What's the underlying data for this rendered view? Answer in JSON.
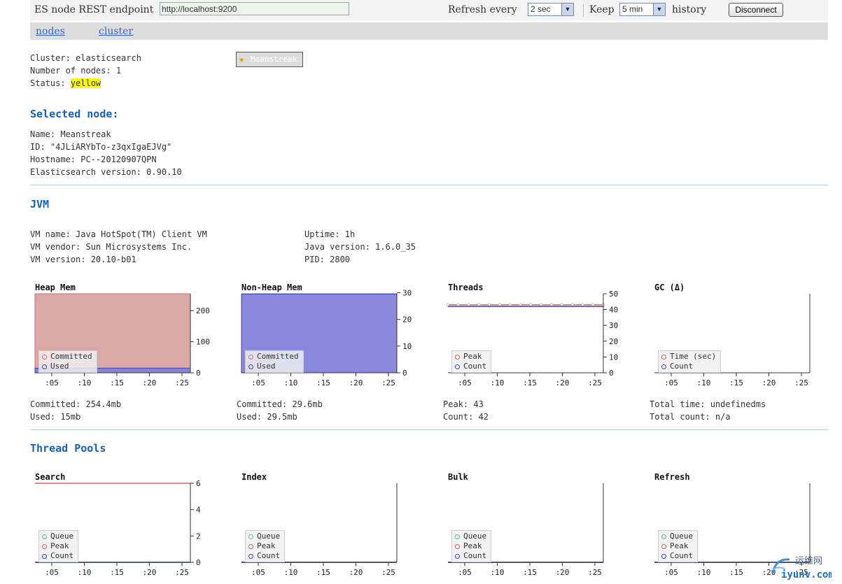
{
  "toolbar": {
    "endpoint_label": "ES node REST endpoint",
    "endpoint_value": "http://localhost:9200",
    "refresh_label": "Refresh every",
    "refresh_value": "2 sec",
    "keep_label": "Keep",
    "keep_value": "5 min",
    "history_label": "history",
    "disconnect_label": "Disconnect"
  },
  "nav": {
    "nodes": "nodes",
    "cluster": "cluster"
  },
  "cluster": {
    "name_line": "Cluster: elasticsearch",
    "nodes_line": "Number of nodes: 1",
    "status_label": "Status: ",
    "status_value": "yellow",
    "node_badge": "Meanstreak"
  },
  "selected_node": {
    "heading": "Selected node:",
    "name_line": "Name: Meanstreak",
    "id_line": "ID: \"4JLiARYbTo-z3qxIgaEJVg\"",
    "hostname_line": "Hostname: PC--20120907QPN",
    "version_line": "Elasticsearch version: 0.90.10"
  },
  "jvm": {
    "heading": "JVM",
    "vm_name": "VM name: Java HotSpot(TM) Client VM",
    "vm_vendor": "VM vendor: Sun Microsystems Inc.",
    "vm_version": "VM version: 20.10-b01",
    "uptime": "Uptime: 1h",
    "java_version": "Java version: 1.6.0_35",
    "pid": "PID: 2800"
  },
  "thread_pools_heading": "Thread Pools",
  "colors": {
    "committed": "#c87070",
    "used": "#4444aa",
    "queue": "#66bb99",
    "peak": "#cc6666",
    "count": "#4444aa",
    "heading": "#1560bd",
    "status_highlight": "#ffff00"
  },
  "chart_data": [
    {
      "id": "heap",
      "type": "area",
      "title": "Heap Mem",
      "x": [
        ":05",
        ":10",
        ":15",
        ":20",
        ":25"
      ],
      "ylim": [
        0,
        254.4
      ],
      "y_ticks": [
        "0",
        "100",
        "200"
      ],
      "series": [
        {
          "name": "Committed",
          "values": [
            254.4,
            254.4,
            254.4,
            254.4,
            254.4,
            254.4
          ]
        },
        {
          "name": "Used",
          "values": [
            15,
            15,
            15,
            15,
            15,
            15
          ]
        }
      ],
      "legend_position": "bottom-left",
      "stats": [
        "Committed: 254.4mb",
        "Used: 15mb"
      ]
    },
    {
      "id": "nonheap",
      "type": "area",
      "title": "Non-Heap Mem",
      "x": [
        ":05",
        ":10",
        ":15",
        ":20",
        ":25"
      ],
      "ylim": [
        0,
        29.6
      ],
      "y_ticks": [
        "0",
        "10",
        "20",
        "30"
      ],
      "series": [
        {
          "name": "Committed",
          "values": [
            29.6,
            29.6,
            29.6,
            29.6,
            29.6,
            29.6
          ]
        },
        {
          "name": "Used",
          "values": [
            29.5,
            29.5,
            29.5,
            29.5,
            29.5,
            29.5
          ]
        }
      ],
      "legend_position": "bottom-left",
      "stats": [
        "Committed: 29.6mb",
        "Used: 29.5mb"
      ]
    },
    {
      "id": "threads",
      "type": "line",
      "title": "Threads",
      "x": [
        ":05",
        ":10",
        ":15",
        ":20",
        ":25"
      ],
      "ylim": [
        0,
        50
      ],
      "y_ticks": [
        "0",
        "10",
        "20",
        "30",
        "40",
        "50"
      ],
      "series": [
        {
          "name": "Peak",
          "values": [
            43,
            43,
            43,
            43,
            43,
            43,
            43,
            43,
            43,
            43,
            43,
            43,
            43,
            43,
            43,
            43
          ]
        },
        {
          "name": "Count",
          "values": [
            42,
            42,
            42,
            42,
            42,
            42,
            42,
            42,
            42,
            42,
            42,
            42,
            42,
            42,
            42,
            42
          ]
        }
      ],
      "legend_position": "bottom-left",
      "stats": [
        "Peak: 43",
        "Count: 42"
      ]
    },
    {
      "id": "gc",
      "type": "line",
      "title": "GC (Δ)",
      "x": [
        ":05",
        ":10",
        ":15",
        ":20",
        ":25"
      ],
      "ylim": [
        0,
        1
      ],
      "y_ticks": [],
      "series": [
        {
          "name": "Time (sec)",
          "values": []
        },
        {
          "name": "Count",
          "values": []
        }
      ],
      "legend_position": "bottom-left",
      "stats": [
        "Total time: undefinedms",
        "Total count: n/a"
      ]
    },
    {
      "id": "search",
      "type": "line",
      "title": "Search",
      "x": [
        ":05",
        ":10",
        ":15",
        ":20",
        ":25"
      ],
      "ylim": [
        0,
        6
      ],
      "y_ticks": [
        "0",
        "2",
        "4",
        "6"
      ],
      "series": [
        {
          "name": "Queue",
          "values": [
            0,
            0,
            0,
            0,
            0,
            0,
            0,
            0,
            0,
            0,
            0,
            0,
            0,
            0,
            0,
            0
          ]
        },
        {
          "name": "Peak",
          "values": [
            6,
            6,
            6,
            6,
            6,
            6,
            6,
            6,
            6,
            6,
            6,
            6,
            6,
            6,
            6,
            6
          ]
        },
        {
          "name": "Count",
          "values": [
            0,
            0,
            0,
            0,
            0,
            0,
            0,
            0,
            0,
            0,
            0,
            0,
            0,
            0,
            0,
            0
          ]
        }
      ],
      "legend_position": "bottom-left"
    },
    {
      "id": "index",
      "type": "line",
      "title": "Index",
      "x": [
        ":05",
        ":10",
        ":15",
        ":20",
        ":25"
      ],
      "ylim": [
        0,
        1
      ],
      "y_ticks": [],
      "series": [
        {
          "name": "Queue",
          "values": [
            0,
            0,
            0,
            0,
            0,
            0,
            0,
            0,
            0,
            0,
            0,
            0,
            0,
            0,
            0,
            0
          ]
        },
        {
          "name": "Peak",
          "values": [
            0,
            0,
            0,
            0,
            0,
            0,
            0,
            0,
            0,
            0,
            0,
            0,
            0,
            0,
            0,
            0
          ]
        },
        {
          "name": "Count",
          "values": [
            0,
            0,
            0,
            0,
            0,
            0,
            0,
            0,
            0,
            0,
            0,
            0,
            0,
            0,
            0,
            0
          ]
        }
      ],
      "legend_position": "bottom-left"
    },
    {
      "id": "bulk",
      "type": "line",
      "title": "Bulk",
      "x": [
        ":05",
        ":10",
        ":15",
        ":20",
        ":25"
      ],
      "ylim": [
        0,
        1
      ],
      "y_ticks": [],
      "series": [
        {
          "name": "Queue",
          "values": [
            0,
            0,
            0,
            0,
            0,
            0,
            0,
            0,
            0,
            0,
            0,
            0,
            0,
            0,
            0,
            0
          ]
        },
        {
          "name": "Peak",
          "values": [
            0,
            0,
            0,
            0,
            0,
            0,
            0,
            0,
            0,
            0,
            0,
            0,
            0,
            0,
            0,
            0
          ]
        },
        {
          "name": "Count",
          "values": [
            0,
            0,
            0,
            0,
            0,
            0,
            0,
            0,
            0,
            0,
            0,
            0,
            0,
            0,
            0,
            0
          ]
        }
      ],
      "legend_position": "bottom-left"
    },
    {
      "id": "refresh",
      "type": "line",
      "title": "Refresh",
      "x": [
        ":05",
        ":10",
        ":15",
        ":20",
        ":25"
      ],
      "ylim": [
        0,
        1
      ],
      "y_ticks": [],
      "series": [
        {
          "name": "Queue",
          "values": [
            0,
            0,
            0,
            0,
            0,
            0,
            0,
            0,
            0,
            0,
            0,
            0,
            0,
            0,
            0,
            0
          ]
        },
        {
          "name": "Peak",
          "values": [
            0,
            0,
            0,
            0,
            0,
            0,
            0,
            0,
            0,
            0,
            0,
            0,
            0,
            0,
            0,
            0
          ]
        },
        {
          "name": "Count",
          "values": [
            0,
            0,
            0,
            0,
            0,
            0,
            0,
            0,
            0,
            0,
            0,
            0,
            0,
            0,
            0,
            0
          ]
        }
      ],
      "legend_position": "bottom-left"
    }
  ],
  "watermark": {
    "text": "运维网",
    "domain": "iyunv.com"
  }
}
